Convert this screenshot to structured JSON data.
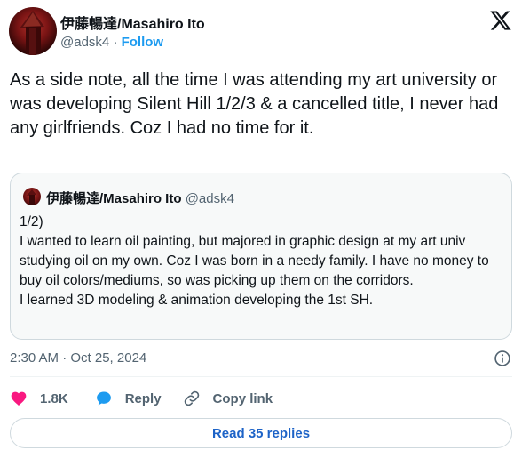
{
  "author": {
    "name": "伊藤暢達/Masahiro Ito",
    "handle": "@adsk4",
    "separator": "·",
    "follow_label": "Follow",
    "avatar_icon": "pyramid-head-avatar"
  },
  "header": {
    "logo_icon": "x-logo-icon"
  },
  "tweet": {
    "text": "As a side note, all the time I was attending my art university or was developing Silent Hill 1/2/3 & a cancelled title, I never had any girlfriends. Coz I had no time for it."
  },
  "quote": {
    "name": "伊藤暢達/Masahiro Ito",
    "handle": "@adsk4",
    "lines": [
      "1/2)",
      "I wanted to learn oil painting, but majored in graphic design at my art univ studying oil on my own. Coz I was born in a needy family. I have no money to buy oil colors/mediums, so was picking up them on the corridors.",
      "I learned 3D modeling & animation developing the 1st SH."
    ]
  },
  "meta": {
    "timestamp": "2:30 AM · Oct 25, 2024",
    "info_icon": "info-icon"
  },
  "actions": {
    "like": {
      "count": "1.8K",
      "icon": "heart-icon",
      "color": "#f91880"
    },
    "reply": {
      "label": "Reply",
      "icon": "reply-bubble-icon",
      "color": "#1d9bf0"
    },
    "copy": {
      "label": "Copy link",
      "icon": "link-icon"
    }
  },
  "footer": {
    "read_replies_label": "Read 35 replies"
  },
  "colors": {
    "accent": "#1d9bf0",
    "muted": "#536471",
    "text": "#0f1419",
    "border": "#cfd9de"
  }
}
